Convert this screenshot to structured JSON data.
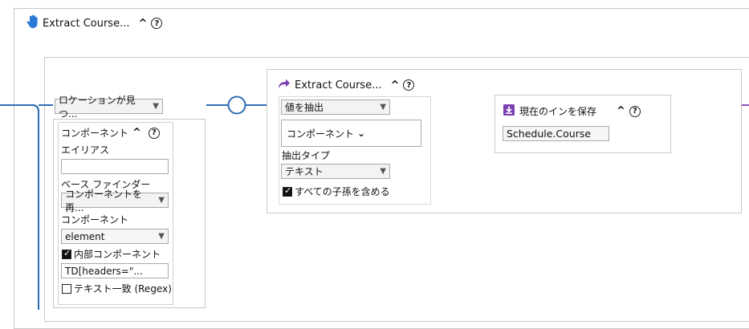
{
  "outer": {
    "title": "Extract Course...",
    "caret": "^",
    "help": "?"
  },
  "location": {
    "select_value": "ロケーションが見つ...",
    "component_header": "コンポーネント",
    "caret": "^",
    "help": "?",
    "alias_label": "エイリアス",
    "alias_value": "",
    "base_finder_label": "ベース ファインダー",
    "base_finder_value": "コンポーネントを再...",
    "component_label": "コンポーネント",
    "component_value": "element",
    "inner_component_label": "内部コンポーネント",
    "inner_component_checked": true,
    "selector_value": "TD[headers=\"...",
    "text_match_label": "テキスト一致 (Regex)",
    "text_match_checked": false
  },
  "extract_step": {
    "title": "Extract Course...",
    "caret": "^",
    "help": "?",
    "action_value": "値を抽出",
    "component_value": "コンポーネント",
    "extract_type_label": "抽出タイプ",
    "extract_type_value": "テキスト",
    "include_children_label": "すべての子孫を含める",
    "include_children_checked": true
  },
  "save_step": {
    "title": "現在のインを保存",
    "caret": "^",
    "help": "?",
    "value": "Schedule.Course"
  },
  "colors": {
    "blue_line": "#2e6db4",
    "purple_line": "#8e4fb8",
    "hand_icon": "#2b7bd6",
    "arrow_icon": "#7a3fb0",
    "save_icon": "#7a3fb0"
  }
}
